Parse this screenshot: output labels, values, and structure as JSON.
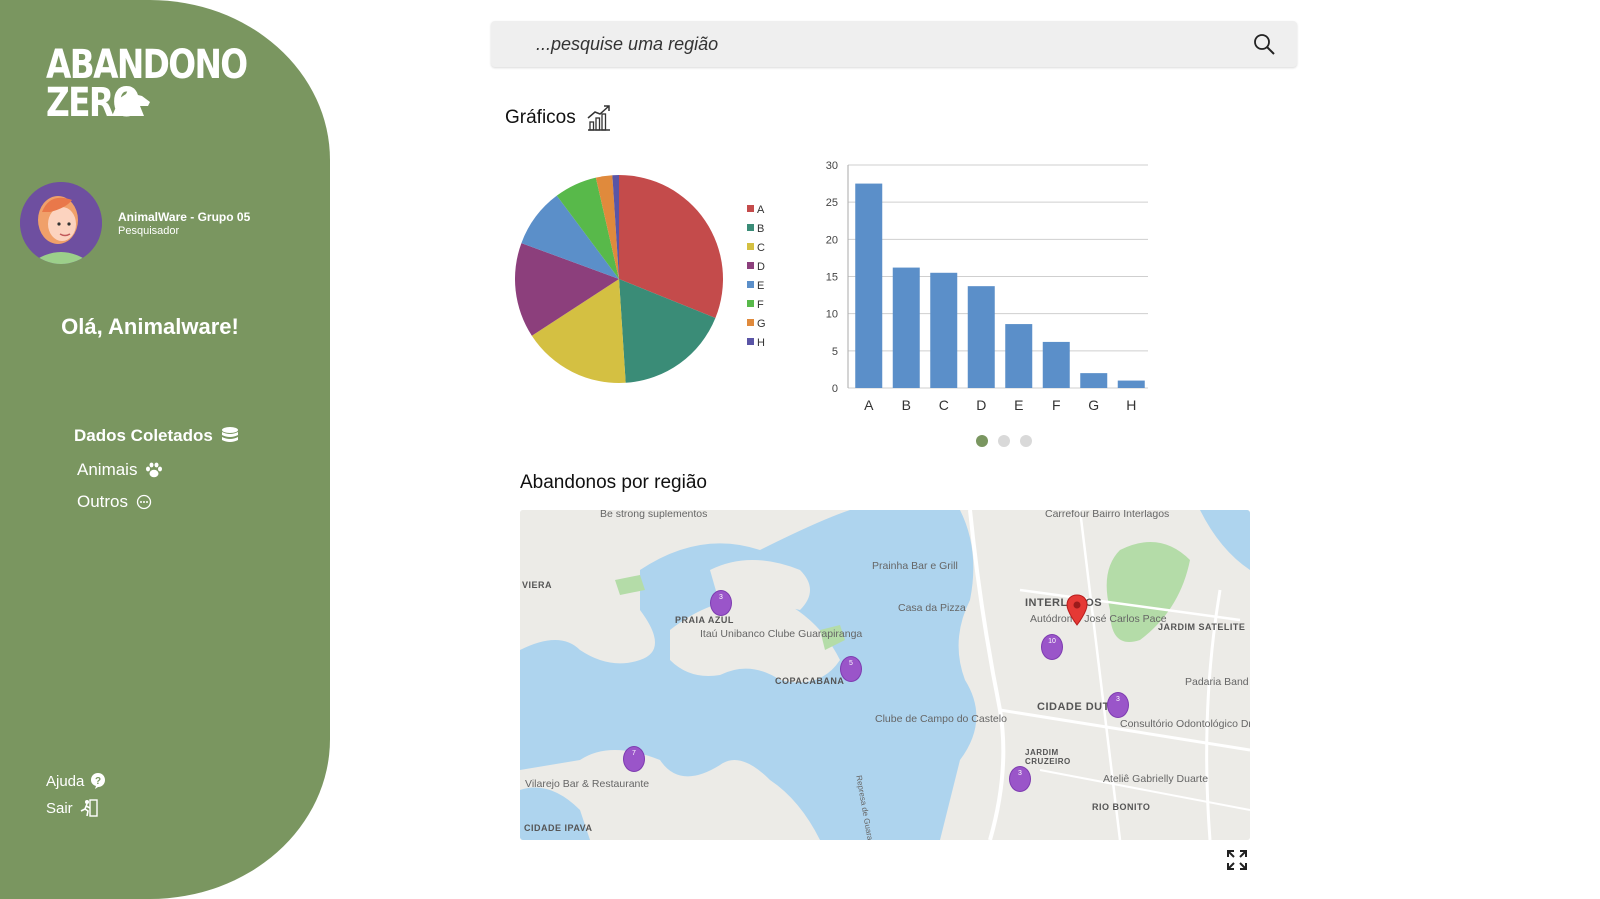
{
  "brand": {
    "line1": "ABANDONO",
    "line2": "ZERO"
  },
  "user": {
    "name": "AnimalWare - Grupo 05",
    "role": "Pesquisador",
    "avatar_icon": "woman-avatar-icon"
  },
  "greeting": "Olá, Animalware!",
  "nav": {
    "header": {
      "label": "Dados Coletados",
      "icon": "database-icon"
    },
    "items": [
      {
        "label": "Animais",
        "icon": "paw-icon"
      },
      {
        "label": "Outros",
        "icon": "more-circle-icon"
      }
    ]
  },
  "footer_nav": [
    {
      "label": "Ajuda",
      "icon": "help-icon"
    },
    {
      "label": "Sair",
      "icon": "exit-icon"
    }
  ],
  "search": {
    "placeholder": "...pesquise uma região"
  },
  "charts_section": {
    "title": "Gráficos",
    "icon": "growth-chart-icon"
  },
  "map_section": {
    "title": "Abandonos por região"
  },
  "colors": {
    "sidebar": "#7a9660",
    "bar": "#5b8fc9",
    "cluster": "#9a55c9",
    "pin": "#e53935"
  },
  "chart_data": [
    {
      "type": "pie",
      "categories": [
        "A",
        "B",
        "C",
        "D",
        "E",
        "F",
        "G",
        "H"
      ],
      "values": [
        30.5,
        17.5,
        16.5,
        14.5,
        9.0,
        6.5,
        2.5,
        1.0
      ],
      "colors": [
        "#c44b4b",
        "#3a8c77",
        "#d4c042",
        "#8c3f7c",
        "#5b8fc9",
        "#58b94a",
        "#e08a3c",
        "#5a55a6"
      ],
      "legend": "right"
    },
    {
      "type": "bar",
      "categories": [
        "A",
        "B",
        "C",
        "D",
        "E",
        "F",
        "G",
        "H"
      ],
      "values": [
        27.5,
        16.2,
        15.5,
        13.7,
        8.6,
        6.2,
        2.0,
        1.0
      ],
      "ylim": [
        0,
        30
      ],
      "yticks": [
        0,
        5,
        10,
        15,
        20,
        25,
        30
      ],
      "grid": true
    }
  ],
  "carousel": {
    "count": 3,
    "active": 0
  },
  "map": {
    "areas": [
      "VIERA",
      "PRAIA AZUL",
      "COPACABANA",
      "INTERLAGOS",
      "JARDIM SATELITE",
      "CIDADE DUTRA",
      "JARDIM CRUZEIRO",
      "RIO BONITO",
      "CIDADE IPAVA"
    ],
    "pois": [
      "Be strong suplementos",
      "Carrefour Bairro Interlagos",
      "Prainha Bar e Grill",
      "Casa da Pizza",
      "Itaú Unibanco Clube Guarapiranga",
      "Autódromo José Carlos Pace",
      "Padaria Band",
      "Clube de Campo do Castelo",
      "Consultório Odontológico Dra...",
      "Ateliê Gabrielly Duarte",
      "Vilarejo Bar & Restaurante",
      "Represa de Guarapiranga"
    ],
    "clusters": [
      3,
      5,
      10,
      3,
      7,
      3
    ]
  },
  "expand_icon": "fullscreen-icon"
}
